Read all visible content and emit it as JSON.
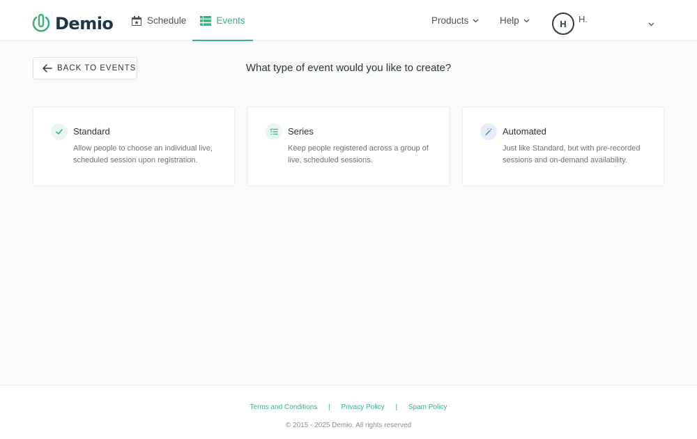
{
  "header": {
    "brand": "Demio",
    "nav": {
      "schedule": "Schedule",
      "events": "Events",
      "products": "Products",
      "help": "Help"
    },
    "user": {
      "avatar_initial": "H",
      "name": "H."
    }
  },
  "main": {
    "back_button": "BACK TO EVENTS",
    "title": "What type of event would you like to create?",
    "cards": [
      {
        "title": "Standard",
        "description": "Allow people to choose an individual live, scheduled session upon registration.",
        "icon": "check-icon"
      },
      {
        "title": "Series",
        "description": "Keep people registered across a group of live, scheduled sessions.",
        "icon": "list-icon"
      },
      {
        "title": "Automated",
        "description": "Just like Standard, but with pre-recorded sessions and on-demand availability.",
        "icon": "magic-wand-icon"
      }
    ]
  },
  "footer": {
    "links": {
      "terms": "Terms and Conditions",
      "privacy": "Privacy Policy",
      "spam": "Spam Policy",
      "separator": "|"
    },
    "copyright": "© 2015 - 2025 Demio. All rights reserved"
  },
  "colors": {
    "accent": "#36b37e",
    "brand_text": "#1f3447",
    "automated_icon": "#4a78c9"
  }
}
